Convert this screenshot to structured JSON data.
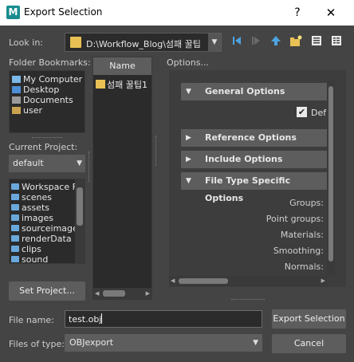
{
  "window": {
    "title": "Export Selection",
    "app_icon_letter": "M",
    "help_symbol": "?",
    "close_symbol": "✕"
  },
  "look_in": {
    "label": "Look in:",
    "path": "D:\\Workflow_Blog\\섬패 꿀팁"
  },
  "bookmarks": {
    "label": "Folder Bookmarks:",
    "items": [
      "My Computer",
      "Desktop",
      "Documents",
      "user"
    ]
  },
  "current_project": {
    "label": "Current Project:",
    "value": "default",
    "folders": [
      "Workspace F",
      "scenes",
      "assets",
      "images",
      "sourceimage",
      "renderData",
      "clips",
      "sound"
    ],
    "set_button": "Set Project..."
  },
  "file_list": {
    "column_header": "Name",
    "items": [
      "섬패 꿀팁1"
    ]
  },
  "options": {
    "label": "Options...",
    "sections": {
      "general": "General Options",
      "reference": "Reference Options",
      "include": "Include Options",
      "file_type": "File Type Specific Options"
    },
    "default_checkbox": "Def",
    "file_type_items": [
      "Groups:",
      "Point groups:",
      "Materials:",
      "Smoothing:",
      "Normals:"
    ]
  },
  "file_name": {
    "label": "File name:",
    "value": "test.obj"
  },
  "file_type": {
    "label": "Files of type:",
    "value": "OBJexport"
  },
  "buttons": {
    "export": "Export Selection",
    "cancel": "Cancel"
  },
  "icons": [
    "folder-icon",
    "back-icon",
    "forward-icon",
    "up-folder-icon",
    "new-folder-icon",
    "list-view-icon",
    "detail-view-icon",
    "checkmark-icon"
  ],
  "colors": {
    "background": "#444444",
    "panel": "#2b2b2b",
    "button": "#5d5d5d",
    "folder": "#e8c054",
    "app_icon": "#1a8c8f"
  }
}
